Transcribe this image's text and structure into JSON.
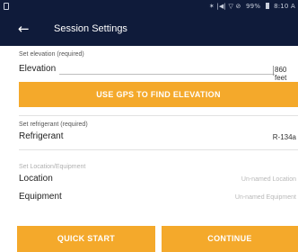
{
  "status_bar": {
    "signal": "✶ |◀| ▽ ⊘",
    "battery": "99%",
    "time": "8:10 A"
  },
  "appbar": {
    "back": "←",
    "title": "Session Settings"
  },
  "elevation": {
    "section_label": "Set elevation (required)",
    "label": "Elevation",
    "value": "860 feet",
    "gps_button": "USE GPS TO FIND ELEVATION"
  },
  "refrigerant": {
    "section_label": "Set refrigerant (required)",
    "label": "Refrigerant",
    "value": "R-134a"
  },
  "location_equipment": {
    "section_label": "Set Location/Equipment",
    "location_label": "Location",
    "location_value": "Un-named Location",
    "equipment_label": "Equipment",
    "equipment_value": "Un-named Equipment"
  },
  "actions": {
    "quick_start": "QUICK START",
    "continue": "CONTINUE"
  },
  "colors": {
    "appbar": "#0f1b3a",
    "accent": "#f4a92b"
  }
}
